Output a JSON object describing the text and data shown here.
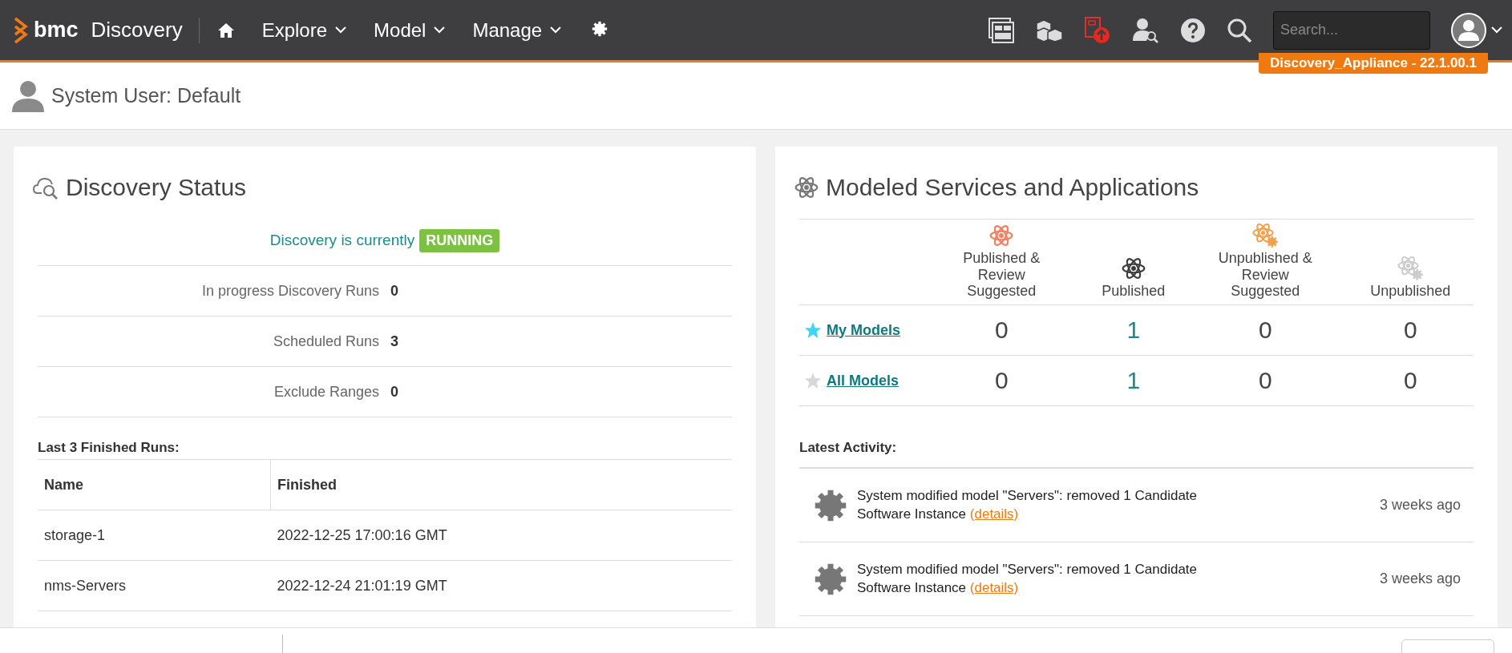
{
  "nav": {
    "brand": "bmc",
    "product": "Discovery",
    "menus": [
      {
        "label": "Explore"
      },
      {
        "label": "Model"
      },
      {
        "label": "Manage"
      }
    ],
    "search": {
      "placeholder": "Search..."
    }
  },
  "appliance_badge": "Discovery_Appliance - 22.1.00.1",
  "user_header": "System User: Default",
  "discovery_status": {
    "title": "Discovery Status",
    "status_prefix": "Discovery is currently",
    "status": "RUNNING",
    "stats": [
      {
        "label": "In progress Discovery Runs",
        "value": "0"
      },
      {
        "label": "Scheduled Runs",
        "value": "3"
      },
      {
        "label": "Exclude Ranges",
        "value": "0"
      }
    ],
    "runs_title": "Last 3 Finished Runs:",
    "columns": [
      "Name",
      "Finished"
    ],
    "rows": [
      [
        "storage-1",
        "2022-12-25 17:00:16 GMT"
      ],
      [
        "nms-Servers",
        "2022-12-24 21:01:19 GMT"
      ]
    ]
  },
  "models": {
    "title": "Modeled Services and Applications",
    "columns": [
      {
        "label": "Published & Review Suggested",
        "kind": "atom",
        "color": "#f47e60"
      },
      {
        "label": "Published",
        "kind": "atom",
        "color": "#3d3d3d"
      },
      {
        "label": "Unpublished & Review Suggested",
        "kind": "atom-gear",
        "color": "#f5a04a"
      },
      {
        "label": "Unpublished",
        "kind": "atom-gear",
        "color": "#cccccc"
      }
    ],
    "rows": [
      {
        "label": "My Models",
        "starred": true,
        "cells": [
          {
            "value": "0",
            "link": false
          },
          {
            "value": "1",
            "link": true
          },
          {
            "value": "0",
            "link": false
          },
          {
            "value": "0",
            "link": false
          }
        ]
      },
      {
        "label": "All Models",
        "starred": false,
        "cells": [
          {
            "value": "0",
            "link": false
          },
          {
            "value": "1",
            "link": true
          },
          {
            "value": "0",
            "link": false
          },
          {
            "value": "0",
            "link": false
          }
        ]
      }
    ],
    "activity_title": "Latest Activity:",
    "activity": [
      {
        "text": "System modified model \"Servers\": removed 1 Candidate Software Instance",
        "link": "(details)",
        "time": "3 weeks ago"
      },
      {
        "text": "System modified model \"Servers\": removed 1 Candidate Software Instance",
        "link": "(details)",
        "time": "3 weeks ago"
      }
    ]
  }
}
